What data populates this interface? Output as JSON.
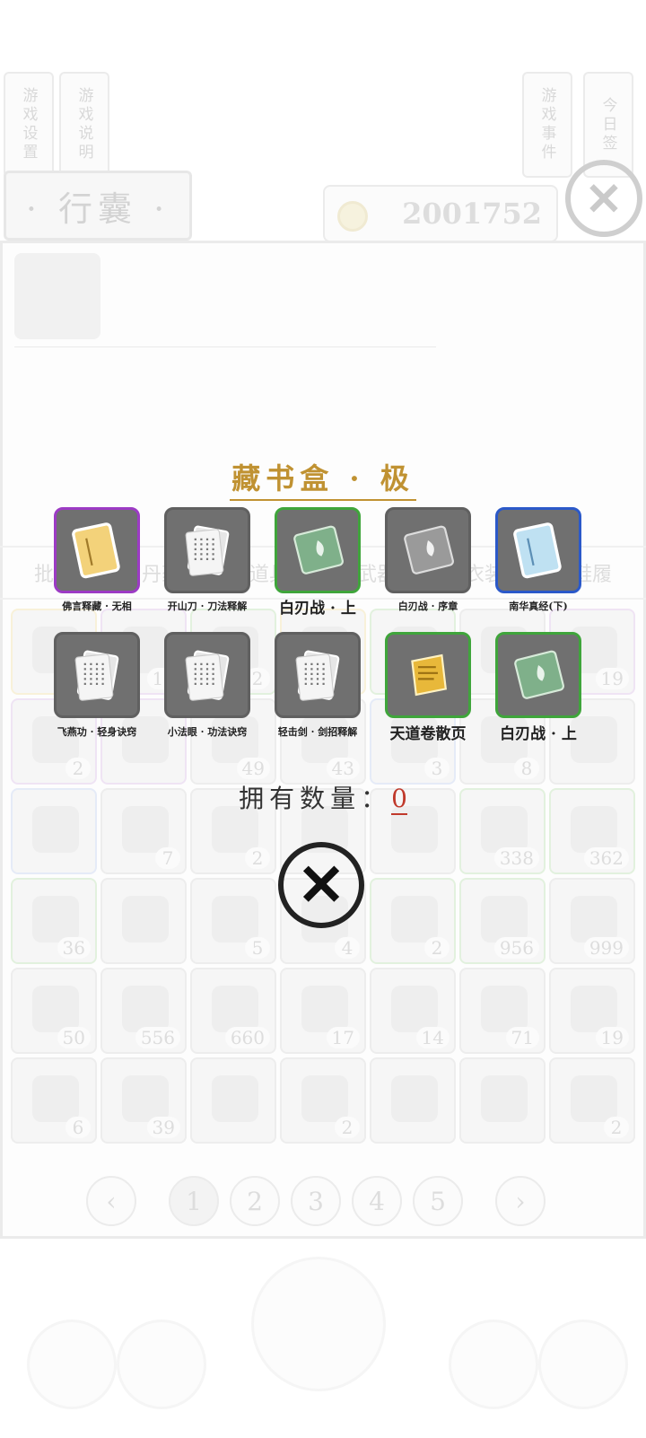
{
  "background": {
    "side_tabs": [
      "游戏设置",
      "游戏说明",
      "游戏事件",
      "今日签"
    ],
    "bag_title": "· 行囊 ·",
    "currency_amount": "2001752",
    "category_tabs": [
      "批量",
      "丹药",
      "道具",
      "武器",
      "衣装",
      "鞋履"
    ],
    "grid_counts": [
      "",
      "14",
      "2",
      "",
      "",
      "",
      "19",
      "2",
      "",
      "49",
      "43",
      "3",
      "8",
      "",
      "",
      "7",
      "2",
      "",
      "",
      "338",
      "362",
      "36",
      "",
      "5",
      "4",
      "2",
      "956",
      "999",
      "50",
      "556",
      "660",
      "17",
      "14",
      "71",
      "19",
      "6",
      "39",
      "",
      "2",
      "",
      "",
      "2"
    ],
    "pager": {
      "prev_icon": "chevron-left-icon",
      "pages": [
        "1",
        "2",
        "3",
        "4",
        "5"
      ],
      "active_page": "1",
      "next_icon": "chevron-right-icon"
    }
  },
  "dialog": {
    "title": "藏书盒 · 极",
    "rewards": [
      {
        "label": "佛言释藏 · 无相",
        "rarity": "purple",
        "icon": "yellow-book-icon"
      },
      {
        "label": "开山刀 · 刀法释解",
        "rarity": "gray",
        "icon": "scroll-pages-icon"
      },
      {
        "label": "白刃战 · 上",
        "rarity": "green",
        "icon": "green-manual-icon"
      },
      {
        "label": "白刃战 · 序章",
        "rarity": "gray",
        "icon": "gray-manual-icon"
      },
      {
        "label": "南华真经(下)",
        "rarity": "blue",
        "icon": "blue-book-icon"
      },
      {
        "label": "飞燕功 · 轻身诀窍",
        "rarity": "gray",
        "icon": "scroll-pages-icon"
      },
      {
        "label": "小法眼 · 功法诀窍",
        "rarity": "gray",
        "icon": "scroll-pages-icon"
      },
      {
        "label": "轻击剑 · 剑招释解",
        "rarity": "gray",
        "icon": "scroll-pages-icon"
      },
      {
        "label": "天道卷散页",
        "rarity": "green",
        "icon": "golden-page-icon"
      },
      {
        "label": "白刃战 · 上",
        "rarity": "green",
        "icon": "green-manual-icon"
      }
    ],
    "owned_label": "拥有数量：",
    "owned_count": "0",
    "close_icon": "brush-close-icon"
  },
  "colors": {
    "title_gold": "#c09232",
    "count_red": "#c0392b",
    "rarity_purple": "#9c3bc4",
    "rarity_green": "#3fa53b",
    "rarity_blue": "#2b59c9",
    "rarity_gray": "#606060"
  }
}
